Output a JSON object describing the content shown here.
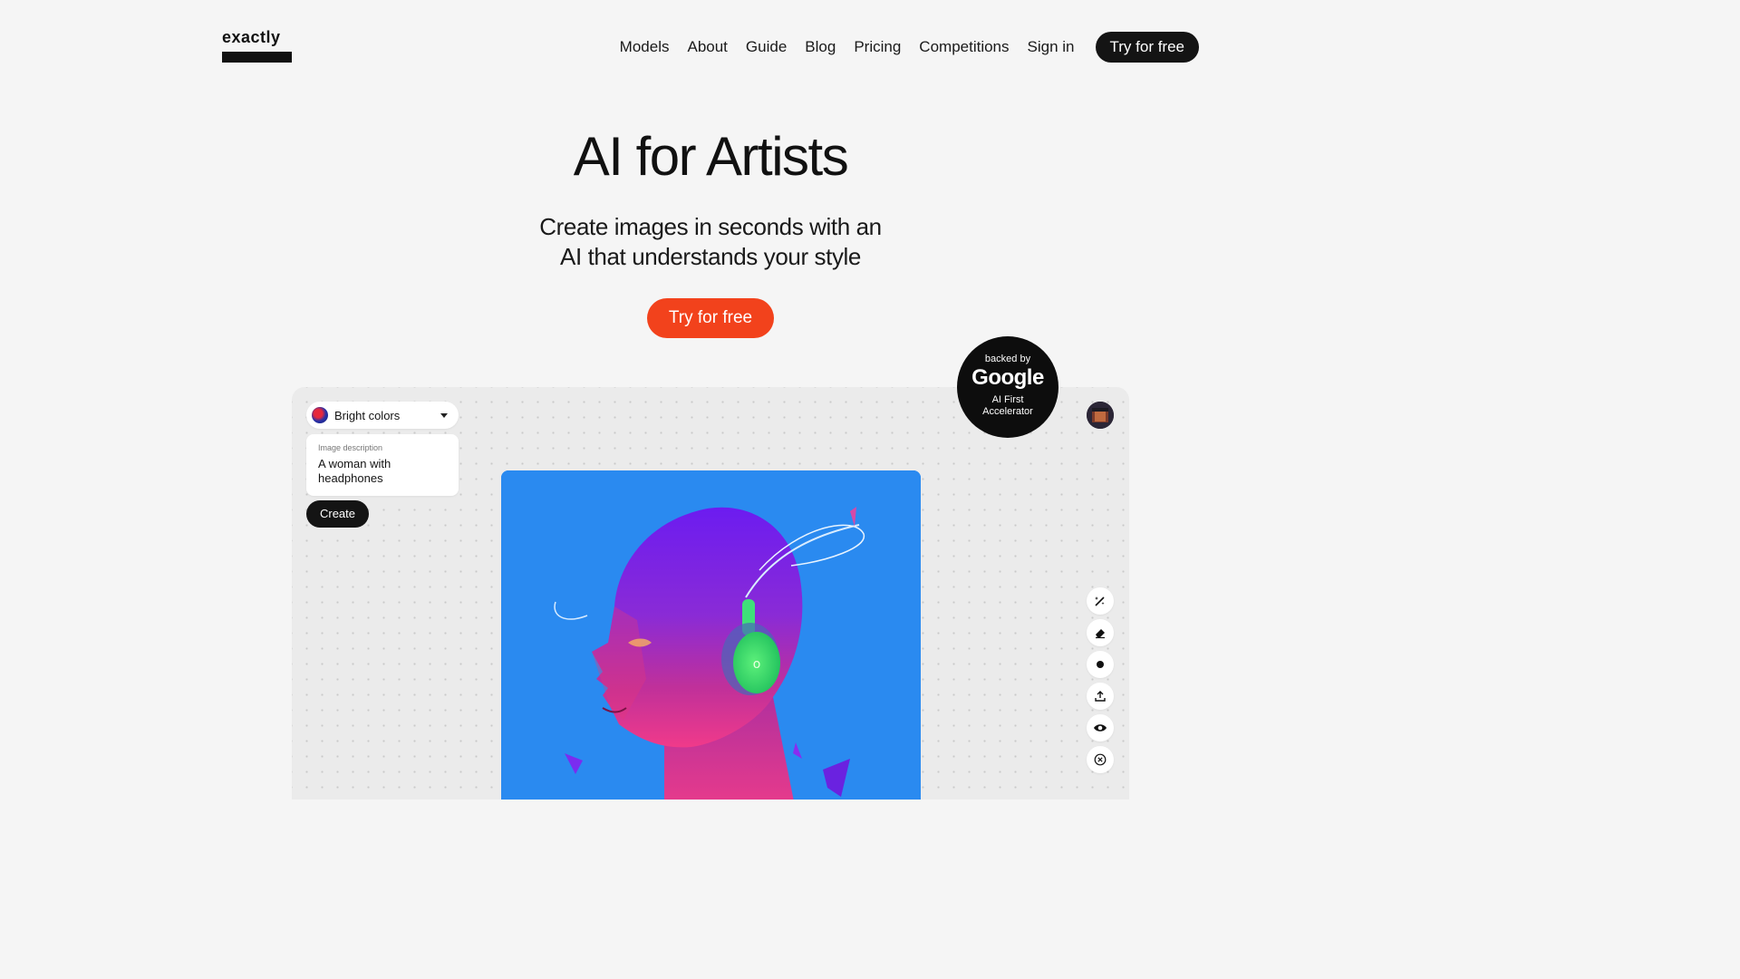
{
  "header": {
    "logo_text": "exactly",
    "nav": [
      "Models",
      "About",
      "Guide",
      "Blog",
      "Pricing",
      "Competitions",
      "Sign in"
    ],
    "cta_label": "Try for free"
  },
  "hero": {
    "title": "AI for Artists",
    "subtitle_line1": "Create images in seconds with an",
    "subtitle_line2": "AI that understands your style",
    "cta_label": "Try for free",
    "cta_color": "#f2421c"
  },
  "demo": {
    "style_select": {
      "value": "Bright colors"
    },
    "description": {
      "label": "Image description",
      "value": "A woman with headphones"
    },
    "create_label": "Create",
    "tools": [
      "magic-wand-icon",
      "eraser-icon",
      "brush-dot-icon",
      "upload-icon",
      "eye-icon",
      "close-circle-icon"
    ]
  },
  "badge": {
    "top": "backed by",
    "brand": "Google",
    "line1": "AI First",
    "line2": "Accelerator"
  }
}
